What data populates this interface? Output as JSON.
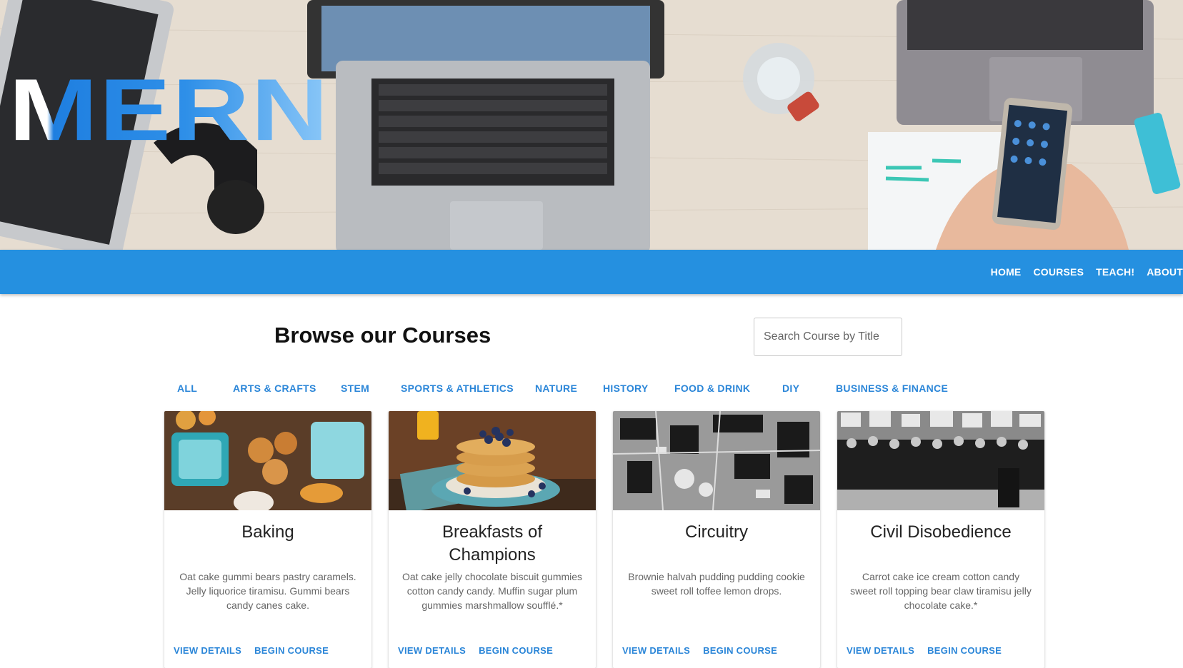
{
  "hero": {
    "logo_text": "MERN"
  },
  "nav": {
    "items": [
      "HOME",
      "COURSES",
      "TEACH!",
      "ABOUT"
    ]
  },
  "main": {
    "title": "Browse our Courses",
    "search_placeholder": "Search Course by Title"
  },
  "categories": [
    "ALL",
    "ARTS & CRAFTS",
    "STEM",
    "SPORTS & ATHLETICS",
    "NATURE",
    "HISTORY",
    "FOOD & DRINK",
    "DIY",
    "BUSINESS & FINANCE"
  ],
  "cards": [
    {
      "title": "Baking",
      "title_line2": "",
      "description": "Oat cake gummi bears pastry caramels. Jelly liquorice tiramisu. Gummi bears candy canes cake.",
      "view_label": "VIEW DETAILS",
      "begin_label": "BEGIN COURSE"
    },
    {
      "title": "Breakfasts of",
      "title_line2": "Champions",
      "description": "Oat cake jelly chocolate biscuit gummies cotton candy candy. Muffin sugar plum gummies marshmallow soufflé.*",
      "view_label": "VIEW DETAILS",
      "begin_label": "BEGIN COURSE"
    },
    {
      "title": "Circuitry",
      "title_line2": "",
      "description": "Brownie halvah pudding pudding cookie sweet roll toffee lemon drops.",
      "view_label": "VIEW DETAILS",
      "begin_label": "BEGIN COURSE"
    },
    {
      "title": "Civil Disobedience",
      "title_line2": "",
      "description": "Carrot cake ice cream cotton candy sweet roll topping bear claw tiramisu jelly chocolate cake.*",
      "view_label": "VIEW DETAILS",
      "begin_label": "BEGIN COURSE"
    }
  ],
  "colors": {
    "nav_bg": "#2590e0",
    "accent": "#2b86d8"
  }
}
